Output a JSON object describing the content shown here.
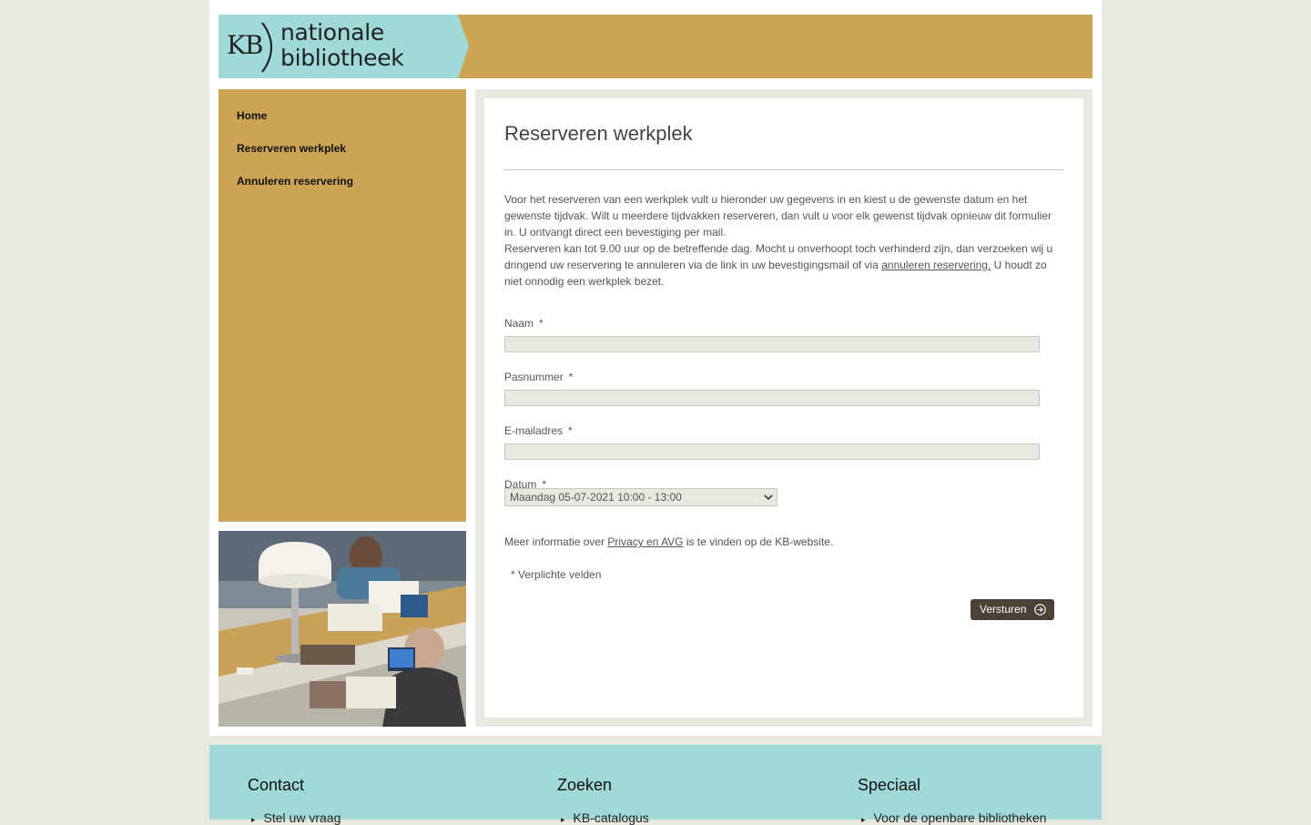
{
  "header": {
    "logo_kb": "KB",
    "logo_line1": "nationale",
    "logo_line2": "bibliotheek"
  },
  "nav": [
    {
      "label": "Home"
    },
    {
      "label": "Reserveren werkplek"
    },
    {
      "label": "Annuleren reservering"
    }
  ],
  "main": {
    "title": "Reserveren werkplek",
    "intro_p1": "Voor het reserveren van een werkplek vult u hieronder uw gegevens in en kiest u de gewenste datum en het gewenste tijdvak. Wilt u meerdere tijdvakken reserveren, dan vult u voor elk gewenst tijdvak opnieuw dit formulier in. U ontvangt direct een bevestiging per mail.",
    "intro_p2_before": "Reserveren kan tot 9.00 uur op de betreffende dag. Mocht u onverhoopt toch verhinderd zijn, dan verzoeken wij u dringend uw reservering te annuleren via de link in uw bevestigingsmail of via ",
    "intro_p2_link": "annuleren reservering.",
    "intro_p2_after": " U houdt zo niet onnodig een werkplek bezet."
  },
  "form": {
    "name_label": "Naam",
    "name_value": "",
    "pas_label": "Pasnummer",
    "pas_value": "",
    "email_label": "E-mailadres",
    "email_value": "",
    "date_label": "Datum",
    "date_selected": "Maandag 05-07-2021 10:00 - 13:00",
    "required_mark": "*",
    "privacy_before": "Meer informatie over ",
    "privacy_link": "Privacy en AVG",
    "privacy_after": " is te vinden op de KB-website.",
    "required_note": "* Verplichte velden",
    "submit_label": "Versturen"
  },
  "footer": {
    "columns": [
      {
        "title": "Contact",
        "item": "Stel uw vraag"
      },
      {
        "title": "Zoeken",
        "item": "KB-catalogus"
      },
      {
        "title": "Speciaal",
        "item": "Voor de openbare bibliotheken"
      }
    ]
  },
  "colors": {
    "brand_gold": "#cca454",
    "brand_teal": "#a0dad8",
    "button_dark": "#4a4239"
  }
}
